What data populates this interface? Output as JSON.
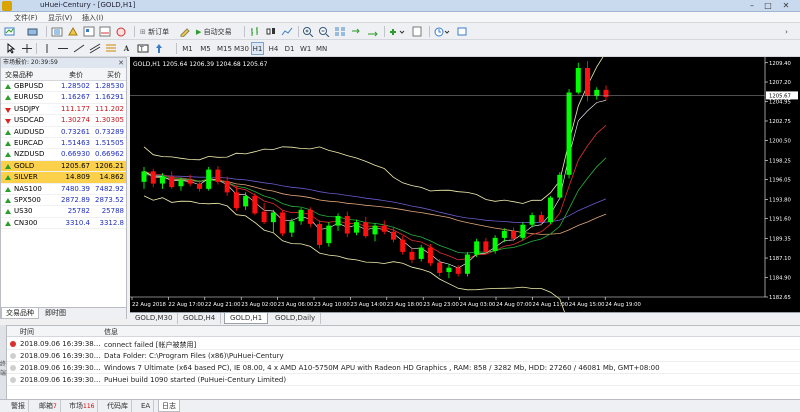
{
  "window": {
    "title": "uHuei-Century - [GOLD,H1]"
  },
  "menu": [
    "文件(F)",
    "显示(V)",
    "插入(I)"
  ],
  "toolbar": {
    "new_order": "新订单",
    "auto_trade": "自动交易",
    "timeframes": [
      "M1",
      "M5",
      "M15",
      "M30",
      "H1",
      "H4",
      "D1",
      "W1",
      "MN"
    ]
  },
  "market_watch": {
    "title": "市场报价: 20:39:59",
    "col_symbol": "交易品种",
    "col_bid": "卖价",
    "col_ask": "买价",
    "rows": [
      {
        "symbol": "GBPUSD",
        "bid": "1.28502",
        "ask": "1.28530",
        "dir": "up"
      },
      {
        "symbol": "EURUSD",
        "bid": "1.16267",
        "ask": "1.16291",
        "dir": "up"
      },
      {
        "symbol": "USDJPY",
        "bid": "111.177",
        "ask": "111.202",
        "dir": "down"
      },
      {
        "symbol": "USDCAD",
        "bid": "1.30274",
        "ask": "1.30305",
        "dir": "down"
      },
      {
        "symbol": "AUDUSD",
        "bid": "0.73261",
        "ask": "0.73289",
        "dir": "up"
      },
      {
        "symbol": "EURCAD",
        "bid": "1.51463",
        "ask": "1.51505",
        "dir": "up"
      },
      {
        "symbol": "NZDUSD",
        "bid": "0.66930",
        "ask": "0.66962",
        "dir": "up"
      },
      {
        "symbol": "GOLD",
        "bid": "1205.67",
        "ask": "1206.21",
        "dir": "up",
        "highlight": true
      },
      {
        "symbol": "SILVER",
        "bid": "14.809",
        "ask": "14.862",
        "dir": "up",
        "highlight": true
      },
      {
        "symbol": "NAS100",
        "bid": "7480.39",
        "ask": "7482.92",
        "dir": "up"
      },
      {
        "symbol": "SPX500",
        "bid": "2872.89",
        "ask": "2873.52",
        "dir": "up"
      },
      {
        "symbol": "US30",
        "bid": "25782",
        "ask": "25788",
        "dir": "up"
      },
      {
        "symbol": "CN300",
        "bid": "3310.4",
        "ask": "3312.8",
        "dir": "up"
      }
    ],
    "tabs": [
      "交易品种",
      "即时图"
    ]
  },
  "chart": {
    "header": "GOLD,H1  1205.64 1206.39 1204.68 1205.67",
    "current_price": "1205.67",
    "price_labels": [
      "1209.40",
      "1207.20",
      "1204.95",
      "1202.75",
      "1200.50",
      "1198.25",
      "1196.05",
      "1193.80",
      "1191.60",
      "1189.35",
      "1187.10",
      "1184.90",
      "1182.65"
    ],
    "time_labels": [
      "22 Aug 2018",
      "22 Aug 17:00",
      "22 Aug 21:00",
      "23 Aug 02:00",
      "23 Aug 06:00",
      "23 Aug 10:00",
      "23 Aug 14:00",
      "23 Aug 18:00",
      "23 Aug 23:00",
      "24 Aug 03:00",
      "24 Aug 07:00",
      "24 Aug 11:00",
      "24 Aug 15:00",
      "24 Aug 19:00"
    ],
    "tabs": [
      "GOLD,M30",
      "GOLD,H4",
      "GOLD,H1",
      "GOLD,Daily"
    ],
    "active_tab": 2
  },
  "chart_data": {
    "type": "candlestick",
    "symbol": "GOLD",
    "timeframe": "H1",
    "ylim": [
      1182.65,
      1209.6
    ],
    "candles": [
      [
        1195.8,
        1197.5,
        1195.0,
        1197.0
      ],
      [
        1197.0,
        1197.3,
        1195.2,
        1195.6
      ],
      [
        1195.6,
        1196.8,
        1195.0,
        1196.4
      ],
      [
        1196.4,
        1197.0,
        1195.0,
        1195.2
      ],
      [
        1195.3,
        1196.3,
        1194.8,
        1196.0
      ],
      [
        1196.0,
        1196.6,
        1195.3,
        1195.6
      ],
      [
        1195.6,
        1196.0,
        1194.7,
        1195.0
      ],
      [
        1195.0,
        1197.5,
        1194.8,
        1197.2
      ],
      [
        1197.2,
        1197.6,
        1195.5,
        1195.8
      ],
      [
        1195.9,
        1196.4,
        1194.2,
        1194.6
      ],
      [
        1194.6,
        1195.4,
        1192.5,
        1192.8
      ],
      [
        1193.0,
        1194.6,
        1192.6,
        1194.2
      ],
      [
        1194.2,
        1194.5,
        1192.0,
        1192.2
      ],
      [
        1192.4,
        1193.4,
        1191.0,
        1191.2
      ],
      [
        1191.2,
        1192.6,
        1190.0,
        1192.3
      ],
      [
        1192.3,
        1192.6,
        1189.6,
        1189.9
      ],
      [
        1190.0,
        1191.6,
        1189.5,
        1191.3
      ],
      [
        1191.3,
        1192.8,
        1190.9,
        1192.6
      ],
      [
        1192.6,
        1192.9,
        1190.6,
        1191.0
      ],
      [
        1191.0,
        1191.4,
        1188.2,
        1188.6
      ],
      [
        1188.8,
        1191.2,
        1188.4,
        1190.8
      ],
      [
        1190.8,
        1192.2,
        1190.2,
        1191.9
      ],
      [
        1191.9,
        1192.4,
        1189.5,
        1189.9
      ],
      [
        1190.0,
        1191.5,
        1189.7,
        1191.2
      ],
      [
        1191.2,
        1191.8,
        1189.4,
        1189.6
      ],
      [
        1189.8,
        1191.1,
        1189.0,
        1190.8
      ],
      [
        1190.8,
        1191.4,
        1189.8,
        1190.1
      ],
      [
        1190.1,
        1190.7,
        1188.9,
        1189.2
      ],
      [
        1189.2,
        1189.6,
        1187.5,
        1187.8
      ],
      [
        1187.8,
        1188.2,
        1186.5,
        1186.9
      ],
      [
        1187.0,
        1188.6,
        1186.7,
        1188.3
      ],
      [
        1188.3,
        1188.7,
        1186.2,
        1186.5
      ],
      [
        1186.6,
        1187.0,
        1185.0,
        1185.4
      ],
      [
        1185.5,
        1186.4,
        1184.8,
        1186.0
      ],
      [
        1186.0,
        1186.3,
        1185.0,
        1185.3
      ],
      [
        1185.3,
        1187.8,
        1185.0,
        1187.5
      ],
      [
        1187.5,
        1189.3,
        1187.2,
        1189.0
      ],
      [
        1189.0,
        1189.4,
        1187.5,
        1187.8
      ],
      [
        1187.9,
        1189.7,
        1187.6,
        1189.4
      ],
      [
        1189.4,
        1190.5,
        1188.9,
        1190.2
      ],
      [
        1190.2,
        1190.6,
        1189.0,
        1189.3
      ],
      [
        1189.4,
        1191.2,
        1189.1,
        1190.9
      ],
      [
        1190.9,
        1192.3,
        1190.6,
        1192.0
      ],
      [
        1192.0,
        1192.4,
        1190.8,
        1191.2
      ],
      [
        1191.2,
        1194.2,
        1191.0,
        1194.0
      ],
      [
        1194.0,
        1196.9,
        1193.8,
        1196.6
      ],
      [
        1196.6,
        1206.4,
        1196.2,
        1206.0
      ],
      [
        1206.0,
        1209.4,
        1205.8,
        1208.8
      ],
      [
        1208.8,
        1209.6,
        1205.0,
        1205.6
      ],
      [
        1205.6,
        1206.6,
        1205.2,
        1206.3
      ],
      [
        1206.3,
        1206.8,
        1205.1,
        1205.5
      ]
    ]
  },
  "terminal": {
    "side_label": "终端",
    "col_time": "时间",
    "col_info": "信息",
    "rows": [
      {
        "time": "2018.09.06 16:39:38...",
        "msg": "connect failed [帐户被禁用]",
        "level": "error"
      },
      {
        "time": "2018.09.06 16:39:30...",
        "msg": "Data Folder: C:\\Program Files (x86)\\PuHuei-Century",
        "level": "info"
      },
      {
        "time": "2018.09.06 16:39:30...",
        "msg": "Windows 7 Ultimate (x64 based PC), IE 08.00, 4 x AMD A10-5750M APU with Radeon HD Graphics , RAM: 858 / 3282 Mb, HDD: 27260 / 46081 Mb, GMT+08:00",
        "level": "info"
      },
      {
        "time": "2018.09.06 16:39:30...",
        "msg": "PuHuei build 1090 started (PuHuei-Century Limited)",
        "level": "info"
      }
    ]
  },
  "bottom_tabs": [
    {
      "label": "警报",
      "count": ""
    },
    {
      "label": "邮箱",
      "count": "7"
    },
    {
      "label": "市场",
      "count": "116"
    },
    {
      "label": "代码库",
      "count": ""
    },
    {
      "label": "EA",
      "count": ""
    },
    {
      "label": "日志",
      "count": ""
    }
  ],
  "colors": {
    "bull": "#00ff00",
    "bear": "#ff1010",
    "chart_bg": "#000000",
    "highlight": "#fbd04b"
  }
}
